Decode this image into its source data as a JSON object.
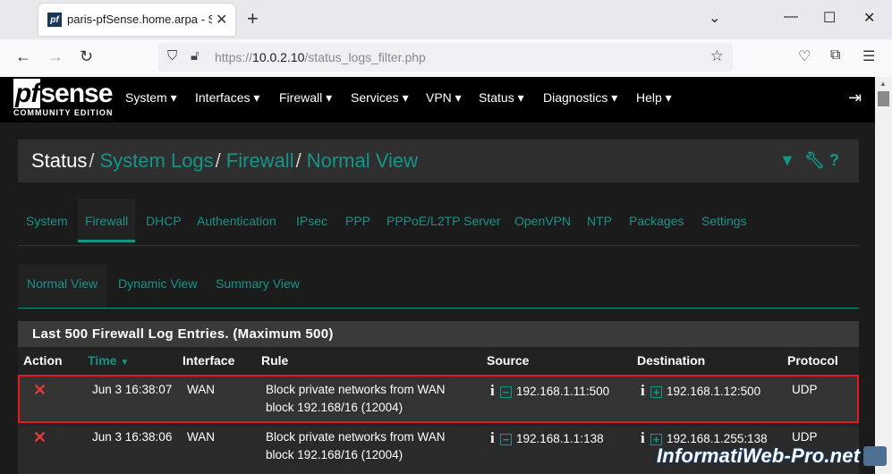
{
  "browser": {
    "tab_title": "paris-pfSense.home.arpa - Status",
    "url_prefix": "https://",
    "url_host": "10.0.2.10",
    "url_path": "/status_logs_filter.php"
  },
  "brand": {
    "logo_pf": "pf",
    "logo_sense": "sense",
    "logo_sub": "COMMUNITY EDITION"
  },
  "menu": [
    "System ▾",
    "Interfaces ▾",
    "Firewall ▾",
    "Services ▾",
    "VPN ▾",
    "Status ▾",
    "Diagnostics ▾",
    "Help ▾"
  ],
  "breadcrumb": {
    "root": "Status",
    "items": [
      "System Logs",
      "Firewall",
      "Normal View"
    ]
  },
  "log_tabs": [
    "System",
    "Firewall",
    "DHCP",
    "Authentication",
    "IPsec",
    "PPP",
    "PPPoE/L2TP Server",
    "OpenVPN",
    "NTP",
    "Packages",
    "Settings"
  ],
  "view_tabs": [
    "Normal View",
    "Dynamic View",
    "Summary View"
  ],
  "panel": {
    "title": "Last 500 Firewall Log Entries. (Maximum 500)",
    "columns": [
      "Action",
      "Time",
      "Interface",
      "Rule",
      "Source",
      "Destination",
      "Protocol"
    ],
    "rows": [
      {
        "action": "✕",
        "time": "Jun 3 16:38:07",
        "interface": "WAN",
        "rule1": "Block private networks from WAN",
        "rule2": "block 192.168/16 (12004)",
        "source": "192.168.1.11:500",
        "destination": "192.168.1.12:500",
        "protocol": "UDP"
      },
      {
        "action": "✕",
        "time": "Jun 3 16:38:06",
        "interface": "WAN",
        "rule1": "Block private networks from WAN",
        "rule2": "block 192.168/16 (12004)",
        "source": "192.168.1.1:138",
        "destination": "192.168.1.255:138",
        "protocol": "UDP"
      }
    ]
  },
  "watermark": "InformatiWeb-Pro.net",
  "colors": {
    "accent": "#139688",
    "block": "#e23b3b",
    "highlight": "#e01b24"
  }
}
